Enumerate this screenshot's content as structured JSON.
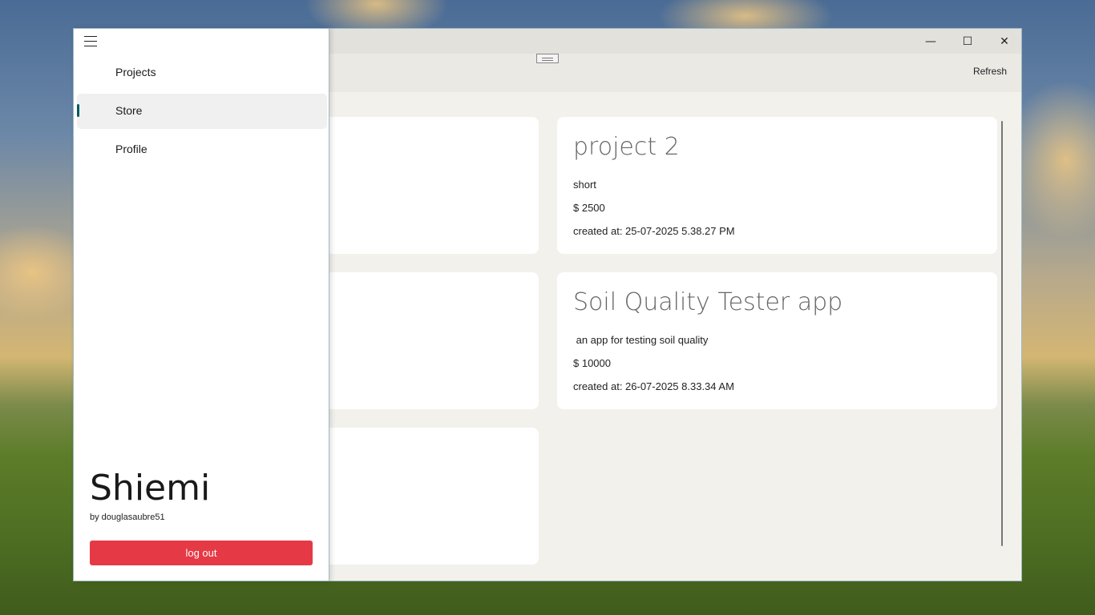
{
  "window": {
    "controls": {
      "minimize": "—",
      "maximize": "☐",
      "close": "✕"
    }
  },
  "toolbar": {
    "refresh_label": "Refresh"
  },
  "projects": [
    {
      "title": "project 2",
      "description": "short",
      "price": "$ 2500",
      "created": "created at: 25-07-2025 5.38.27 PM"
    },
    {
      "title": "Soil Quality Tester app",
      "description": " an app for testing soil quality",
      "price": "$ 10000",
      "created": "created at: 26-07-2025 8.33.34 AM"
    }
  ],
  "sidebar": {
    "items": [
      {
        "label": "Projects"
      },
      {
        "label": "Store"
      },
      {
        "label": "Profile"
      }
    ],
    "selected": "Store",
    "app_name": "Shiemi",
    "byline": "by douglasaubre51",
    "logout_label": "log out",
    "logout_color": "#e63946",
    "accent_color": "#005a5f"
  }
}
